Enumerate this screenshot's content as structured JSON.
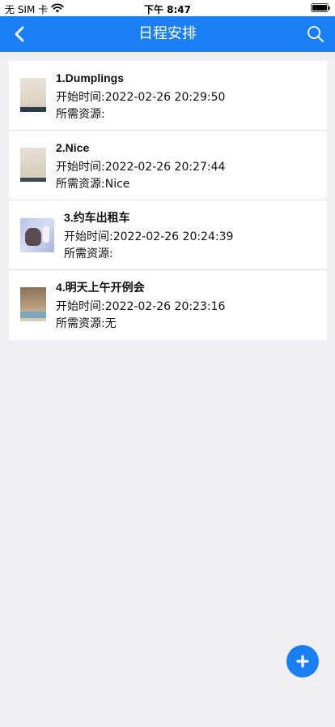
{
  "status_bar": {
    "carrier": "无 SIM 卡",
    "time": "下午 8:47"
  },
  "nav": {
    "title": "日程安排",
    "back_icon": "chevron-left-icon",
    "search_icon": "search-icon",
    "color": "#1a7ff5"
  },
  "schedule": {
    "items": [
      {
        "title": "1.Dumplings",
        "start_label": "开始时间:",
        "start_value": "2022-02-26 20:29:50",
        "resource_label": "所需资源:",
        "resource_value": ""
      },
      {
        "title": "2.Nice",
        "start_label": "开始时间:",
        "start_value": "2022-02-26 20:27:44",
        "resource_label": "所需资源:",
        "resource_value": "Nice"
      },
      {
        "title": "3.约车出租车",
        "start_label": "开始时间:",
        "start_value": "2022-02-26 20:24:39",
        "resource_label": "所需资源:",
        "resource_value": ""
      },
      {
        "title": "4.明天上午开例会",
        "start_label": "开始时间:",
        "start_value": "2022-02-26 20:23:16",
        "resource_label": "所需资源:",
        "resource_value": "无"
      }
    ]
  },
  "fab": {
    "icon": "plus-icon"
  }
}
